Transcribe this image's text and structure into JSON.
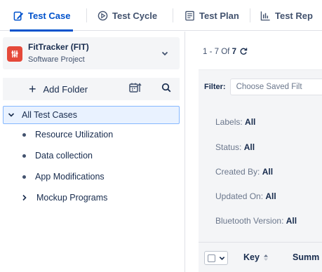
{
  "tabs": [
    {
      "label": "Test Case",
      "icon": "edit-document-icon",
      "active": true
    },
    {
      "label": "Test Cycle",
      "icon": "play-circle-icon",
      "active": false
    },
    {
      "label": "Test Plan",
      "icon": "list-document-icon",
      "active": false
    },
    {
      "label": "Test Rep",
      "icon": "bar-chart-icon",
      "active": false
    }
  ],
  "project": {
    "name": "FitTracker (FIT)",
    "type": "Software Project"
  },
  "toolbar": {
    "add_folder_label": "Add Folder",
    "add_folder_icon": "plus-icon"
  },
  "tree": {
    "root": "All Test Cases",
    "items": [
      {
        "label": "Resource Utilization",
        "kind": "leaf"
      },
      {
        "label": "Data collection",
        "kind": "leaf"
      },
      {
        "label": "App Modifications",
        "kind": "leaf"
      },
      {
        "label": "Mockup Programs",
        "kind": "collapsed"
      }
    ]
  },
  "main": {
    "count_prefix": "1 - 7 Of",
    "count_total": "7",
    "filter_label": "Filter:",
    "filter_placeholder": "Choose Saved Filt",
    "criteria": [
      {
        "label": "Labels",
        "value": "All"
      },
      {
        "label": "Status",
        "value": "All"
      },
      {
        "label": "Created By",
        "value": "All"
      },
      {
        "label": "Updated On",
        "value": "All"
      },
      {
        "label": "Bluetooth Version",
        "value": "All"
      }
    ],
    "columns": [
      "Key",
      "Summ"
    ]
  },
  "colors": {
    "accent": "#0052cc",
    "selected_bg": "#e9f2ff",
    "panel_bg": "#f4f5f7",
    "logo_red": "#e5493a"
  }
}
